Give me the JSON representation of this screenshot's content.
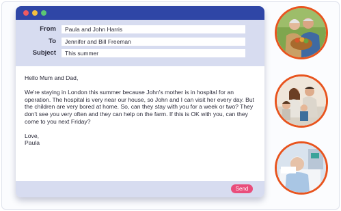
{
  "window": {
    "from_label": "From",
    "from_value": "Paula and John Harris",
    "to_label": "To",
    "to_value": "Jennifer and Bill Freeman",
    "subject_label": "Subject",
    "subject_value": "This summer"
  },
  "message": {
    "greeting": "Hello Mum and Dad,",
    "paragraph": "We're staying in London this summer because John's mother is in hospital for an operation. The hospital is very near our house, so John and I can visit her every day. But the children are very bored at home. So, can they stay with you for a week or two? They don't see you very often and they can help on the farm. If this is OK with you, can they come to you next Friday?",
    "closing": "Love,",
    "signature": "Paula"
  },
  "footer": {
    "send_label": "Send"
  },
  "photos": [
    {
      "subject": "elderly couple holding a basket of vegetables"
    },
    {
      "subject": "family of four on a sofa"
    },
    {
      "subject": "elderly woman in a hospital bed"
    }
  ],
  "colors": {
    "titlebar": "#2f46a6",
    "header_bg": "#d7dcf0",
    "send_button": "#e94d7b",
    "photo_border": "#e8541e"
  }
}
